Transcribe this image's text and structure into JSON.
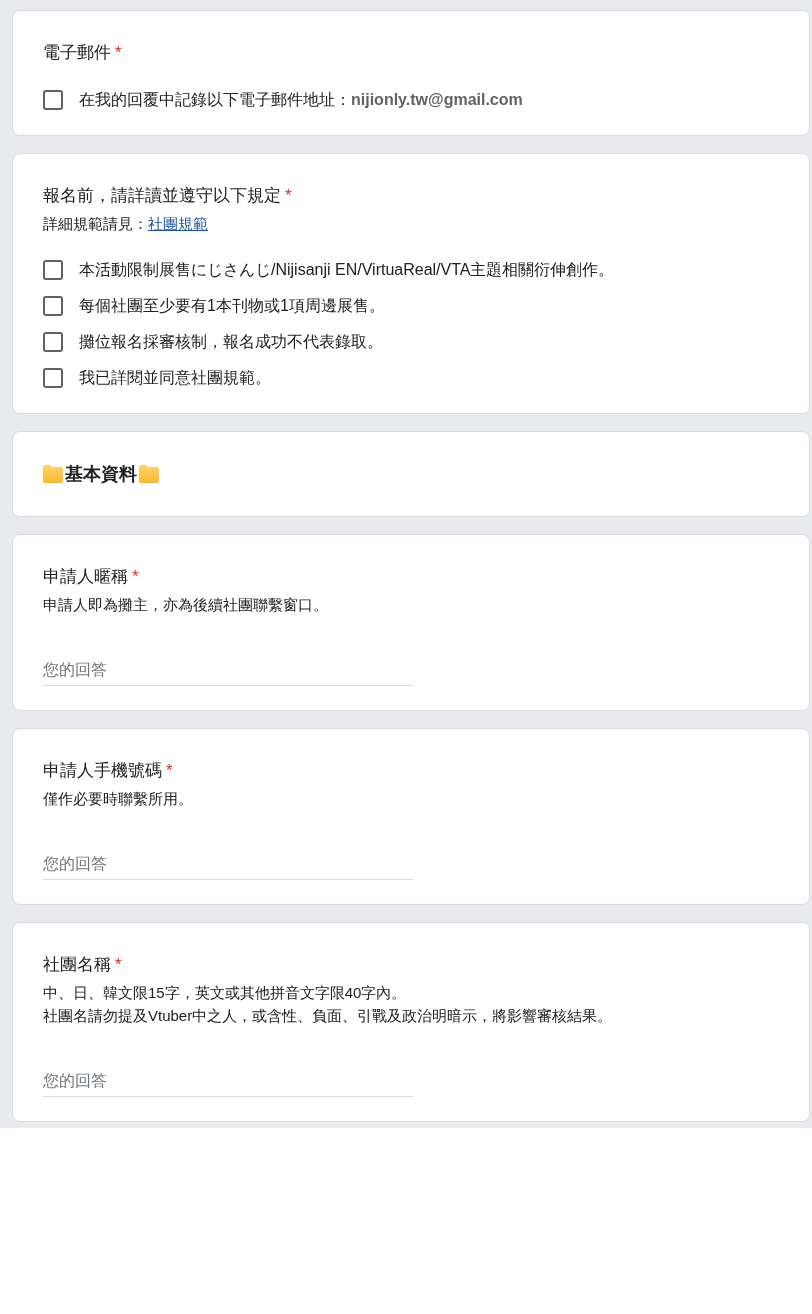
{
  "cards": [
    {
      "kind": "checkbox",
      "title": "電子郵件",
      "required_mark": "*",
      "options": [
        {
          "label": "在我的回覆中記錄以下電子郵件地址：**nijionly.tw@gmail.com**",
          "checked": false
        }
      ]
    },
    {
      "kind": "checkbox",
      "title": "報名前，請詳讀並遵守以下規定",
      "required_mark": "*",
      "description": [
        "詳細規範請見："
      ],
      "link": "社團規範",
      "options": [
        {
          "label": "本活動限制展售にじさんじ/Nijisanji EN/VirtuaReal/VTA主題相關衍伸創作。",
          "checked": false
        },
        {
          "label": "每個社團至少要有1本刊物或1項周邊展售。",
          "checked": false
        },
        {
          "label": "攤位報名採審核制，報名成功不代表錄取。",
          "checked": false
        },
        {
          "label": "我已詳閱並同意社團規範。",
          "checked": false
        }
      ]
    },
    {
      "kind": "section",
      "title": "基本資料"
    },
    {
      "kind": "text",
      "title": "申請人暱稱",
      "required_mark": "*",
      "description": [
        "申請人即為攤主，亦為後續社團聯繫窗口。"
      ],
      "placeholder": "您的回答"
    },
    {
      "kind": "text",
      "title": "申請人手機號碼",
      "required_mark": "*",
      "description": [
        "僅作必要時聯繫所用。"
      ],
      "placeholder": "您的回答"
    },
    {
      "kind": "text",
      "title": "社團名稱",
      "required_mark": "*",
      "description": [
        "中、日、韓文限15字，英文或其他拼音文字限40字內。",
        "社團名請勿提及Vtuber中之人，或含性、負面、引戰及政治明暗示，將影響審核結果。"
      ],
      "placeholder": "您的回答"
    }
  ]
}
